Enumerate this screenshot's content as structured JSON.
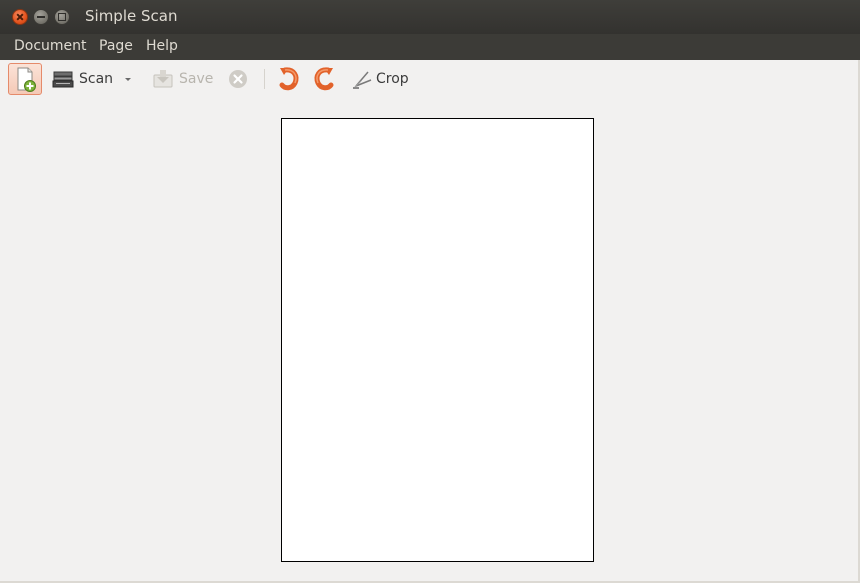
{
  "window": {
    "title": "Simple Scan"
  },
  "menubar": {
    "items": [
      {
        "label": "Document"
      },
      {
        "label": "Page"
      },
      {
        "label": "Help"
      }
    ]
  },
  "toolbar": {
    "new_icon": "new-document-icon",
    "scan_label": "Scan",
    "save_label": "Save",
    "crop_label": "Crop",
    "save_enabled": false,
    "stop_enabled": false
  },
  "colors": {
    "titlebar": "#3c3b37",
    "accent": "#e3531d",
    "page": "#ffffff",
    "background": "#f2f1f0"
  }
}
